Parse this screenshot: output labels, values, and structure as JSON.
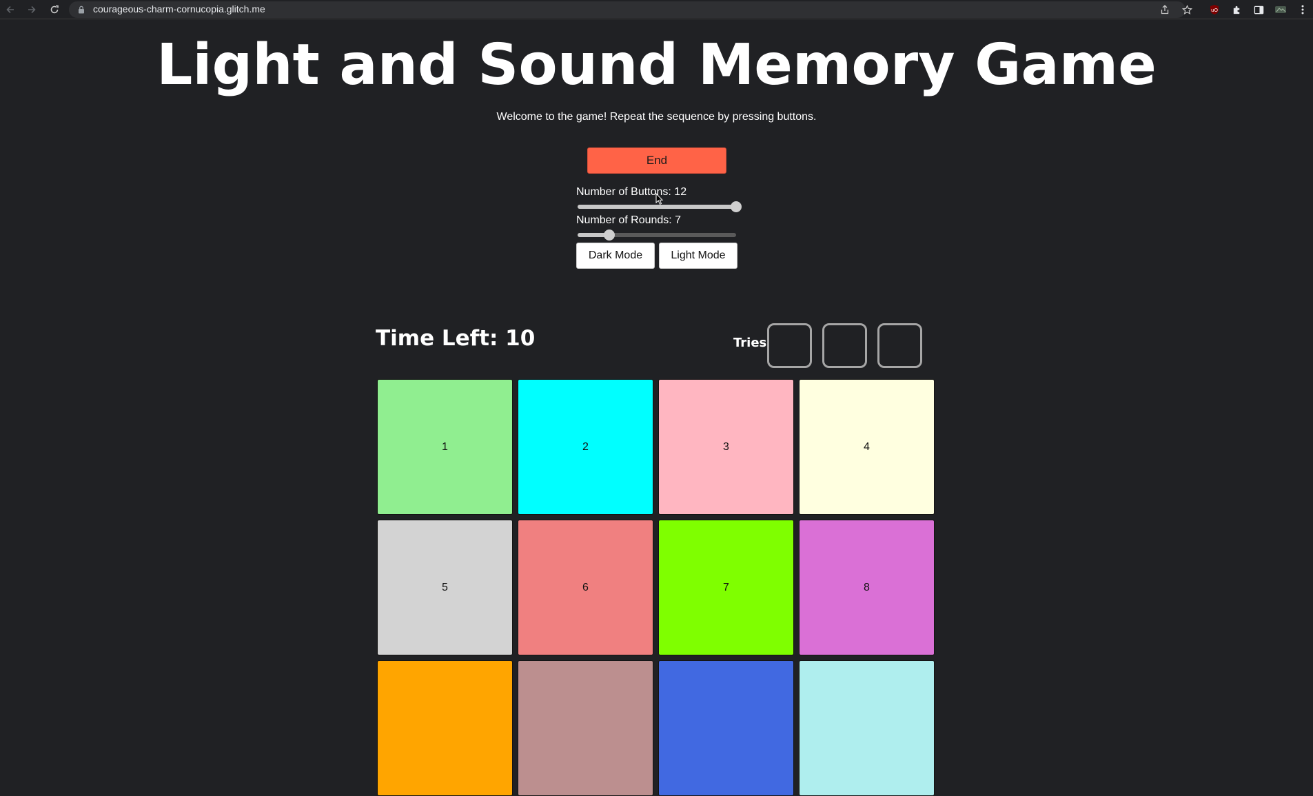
{
  "browser": {
    "url": "courageous-charm-cornucopia.glitch.me"
  },
  "page": {
    "title": "Light and Sound Memory Game",
    "subtitle": "Welcome to the game! Repeat the sequence by pressing buttons."
  },
  "controls": {
    "end_label": "End",
    "buttons_slider": {
      "label": "Number of Buttons: 12",
      "value": 12,
      "fill_fraction": 1.0
    },
    "rounds_slider": {
      "label": "Number of Rounds: 7",
      "value": 7,
      "fill_fraction": 0.2
    },
    "dark_mode_label": "Dark Mode",
    "light_mode_label": "Light Mode"
  },
  "status": {
    "time_left": "Time Left: 10",
    "tries_label": "Tries",
    "tries_count": 3
  },
  "game_buttons": [
    {
      "label": "1",
      "color": "#90EE90"
    },
    {
      "label": "2",
      "color": "#00FFFF"
    },
    {
      "label": "3",
      "color": "#FFB6C1"
    },
    {
      "label": "4",
      "color": "#FFFFE0"
    },
    {
      "label": "5",
      "color": "#D3D3D3"
    },
    {
      "label": "6",
      "color": "#F08080"
    },
    {
      "label": "7",
      "color": "#7FFF00"
    },
    {
      "label": "8",
      "color": "#DA70D6"
    },
    {
      "label": "",
      "color": "#FFA500"
    },
    {
      "label": "",
      "color": "#BC8F8F"
    },
    {
      "label": "",
      "color": "#4169E1"
    },
    {
      "label": "",
      "color": "#AFEEEE"
    }
  ],
  "theme": {
    "background": "#202124",
    "end_button": "#FF6347",
    "try_border": "#A6A6A6"
  }
}
